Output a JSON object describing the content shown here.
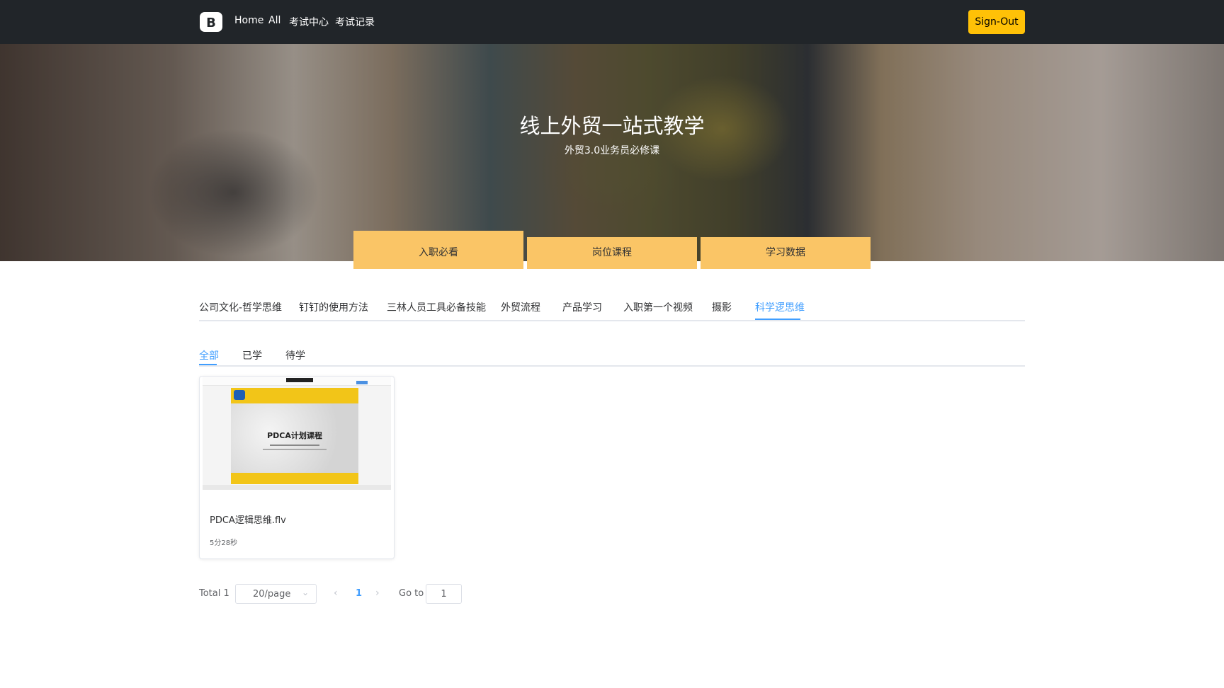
{
  "navbar": {
    "brand_letter": "B",
    "links": [
      "Home",
      "All",
      "考试中心",
      "考试记录"
    ],
    "signout_label": "Sign-Out"
  },
  "hero": {
    "title": "线上外贸一站式教学",
    "subtitle": "外贸3.0业务员必修课",
    "buttons": [
      "入职必看",
      "岗位课程",
      "学习数据"
    ]
  },
  "category_tabs": {
    "items": [
      "公司文化-哲学思维",
      "钉钉的使用方法",
      "三林人员工具必备技能",
      "外贸流程",
      "产品学习",
      "入职第一个视频",
      "摄影",
      "科学逻思维"
    ],
    "active_index": 7
  },
  "status_tabs": {
    "items": [
      "全部",
      "已学",
      "待学"
    ],
    "active_index": 0
  },
  "courses": [
    {
      "title": "PDCA逻辑思维.flv",
      "duration": "5分28秒",
      "thumbnail_title": "PDCA计划课程"
    }
  ],
  "pagination": {
    "total_label": "Total 1",
    "page_size": "20/page",
    "current_page": "1",
    "goto_label": "Go to",
    "goto_value": "1"
  },
  "colors": {
    "navbar": "#212529",
    "signout": "#ffc107",
    "hero_button": "#fac566",
    "active_tab": "#409eff"
  },
  "icons": [
    "bootstrap-logo-icon",
    "chevron-down-icon",
    "chevron-left-icon",
    "chevron-right-icon"
  ]
}
